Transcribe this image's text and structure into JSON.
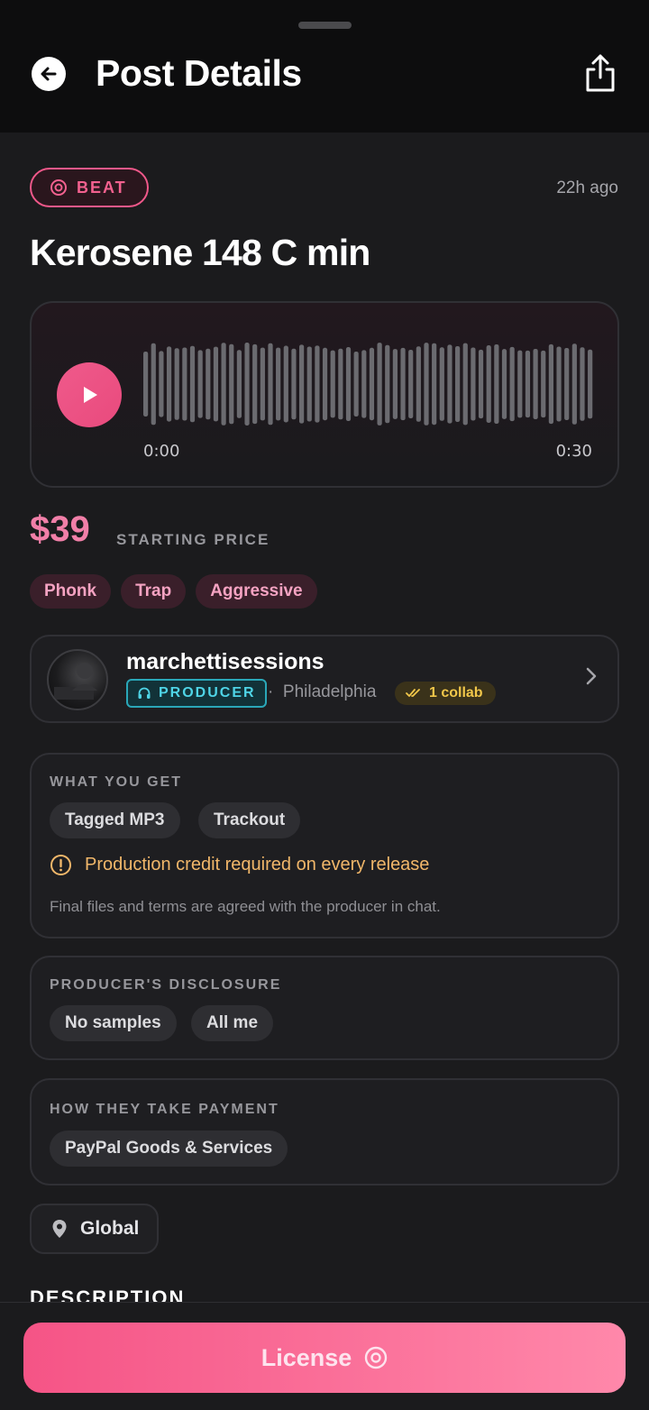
{
  "header": {
    "title": "Post Details"
  },
  "post": {
    "type_badge": "BEAT",
    "time_ago": "22h ago",
    "title": "Kerosene 148 C min"
  },
  "player": {
    "current_time": "0:00",
    "duration": "0:30"
  },
  "pricing": {
    "price": "$39",
    "label": "STARTING PRICE"
  },
  "genre_tags": [
    "Phonk",
    "Trap",
    "Aggressive"
  ],
  "producer": {
    "name": "marchettisessions",
    "role": "PRODUCER",
    "location_sep": "·",
    "location": "Philadelphia",
    "collab": "1 collab"
  },
  "what_you_get": {
    "heading": "WHAT YOU GET",
    "items": [
      "Tagged MP3",
      "Trackout"
    ],
    "warning": "Production credit required on every release",
    "note": "Final files and terms are agreed with the producer in chat."
  },
  "disclosure": {
    "heading": "PRODUCER'S DISCLOSURE",
    "items": [
      "No samples",
      "All me"
    ]
  },
  "payment": {
    "heading": "HOW THEY TAKE PAYMENT",
    "items": [
      "PayPal Goods & Services"
    ]
  },
  "region": {
    "label": "Global"
  },
  "description": {
    "heading": "DESCRIPTION"
  },
  "cta": {
    "label": "License"
  },
  "colors": {
    "accent_pink": "#f0588a",
    "price_pink": "#f17fa8",
    "producer_teal": "#4fd4e6",
    "collab_gold": "#f1c74a",
    "warning_amber": "#f1b76a",
    "background": "#1b1b1d"
  }
}
